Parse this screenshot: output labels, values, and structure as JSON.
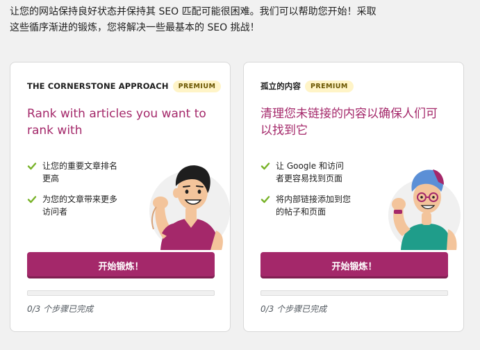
{
  "intro": {
    "line1": "让您的网站保持良好状态并保持其 SEO 匹配可能很困难。我们可以帮助您开始！采取",
    "line2": "这些循序渐进的锻炼，您将解决一些最基本的 SEO 挑战！"
  },
  "cards": [
    {
      "kicker": "THE CORNERSTONE APPROACH",
      "badge": "PREMIUM",
      "title": "Rank with articles you want to rank with",
      "benefits": [
        "让您的重要文章排名更高",
        "为您的文章带来更多访问者"
      ],
      "cta_label": "开始锻炼！",
      "progress_text": "0/3 个步骤已完成",
      "progress_value": 0
    },
    {
      "kicker": "孤立的内容",
      "badge": "PREMIUM",
      "title": "清理您未链接的内容以确保人们可以找到它",
      "benefits": [
        "让 Google 和访问者更容易找到页面",
        "将内部链接添加到您的帖子和页面"
      ],
      "cta_label": "开始锻炼！",
      "progress_text": "0/3 个步骤已完成",
      "progress_value": 0
    }
  ],
  "colors": {
    "brand": "#a4286a",
    "check": "#77b227",
    "badge_bg": "#fff4c7"
  },
  "icons": {
    "check": "check-icon",
    "illustration_left": "flexing-man-illustration",
    "illustration_right": "flexing-woman-illustration"
  }
}
